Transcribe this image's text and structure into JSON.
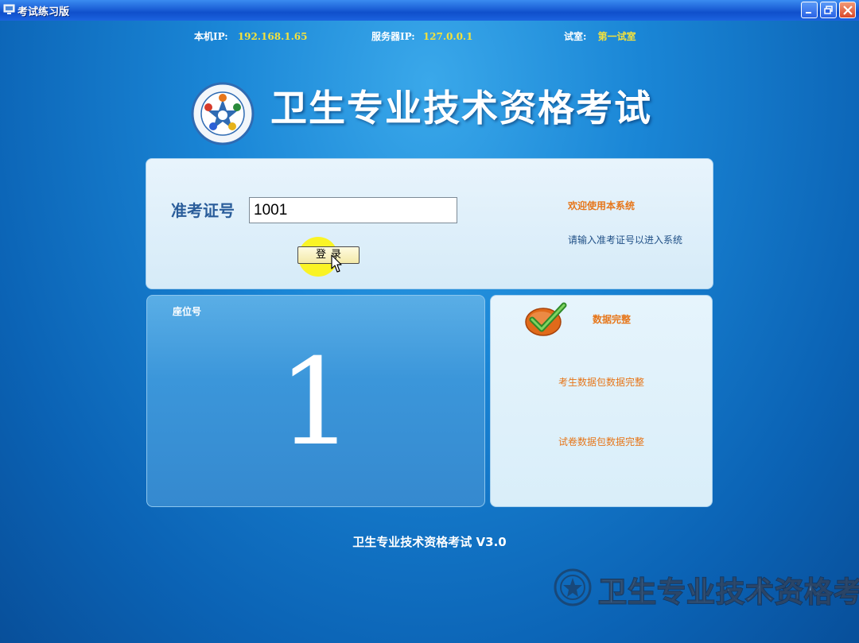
{
  "window": {
    "title": "考试练习版"
  },
  "header": {
    "local_ip_label": "本机IP:",
    "local_ip_value": "192.168.1.65",
    "server_ip_label": "服务器IP:",
    "server_ip_value": "127.0.0.1",
    "room_label": "试室:",
    "room_value": "第一试室"
  },
  "brand": {
    "title": "卫生专业技术资格考试"
  },
  "login": {
    "ticket_label": "准考证号",
    "ticket_value": "1001",
    "login_button": "登录",
    "welcome": "欢迎使用本系统",
    "hint": "请输入准考证号以进入系统"
  },
  "seat": {
    "label": "座位号",
    "number": "1"
  },
  "status": {
    "title": "数据完整",
    "candidate_package": "考生数据包数据完整",
    "paper_package": "试卷数据包数据完整"
  },
  "footer": {
    "version_text": "卫生专业技术资格考试 V3.0",
    "watermark": "卫生专业技术资格考试"
  },
  "icons": {
    "app": "computer-icon",
    "minimize": "minimize-icon",
    "restore": "restore-icon",
    "close": "close-icon",
    "logo": "emblem-logo",
    "status": "check-icon",
    "cursor": "mouse-cursor-icon"
  },
  "colors": {
    "accent_orange": "#e6761a",
    "ip_yellow": "#f4e23c",
    "background_blue": "#1a86d6"
  }
}
